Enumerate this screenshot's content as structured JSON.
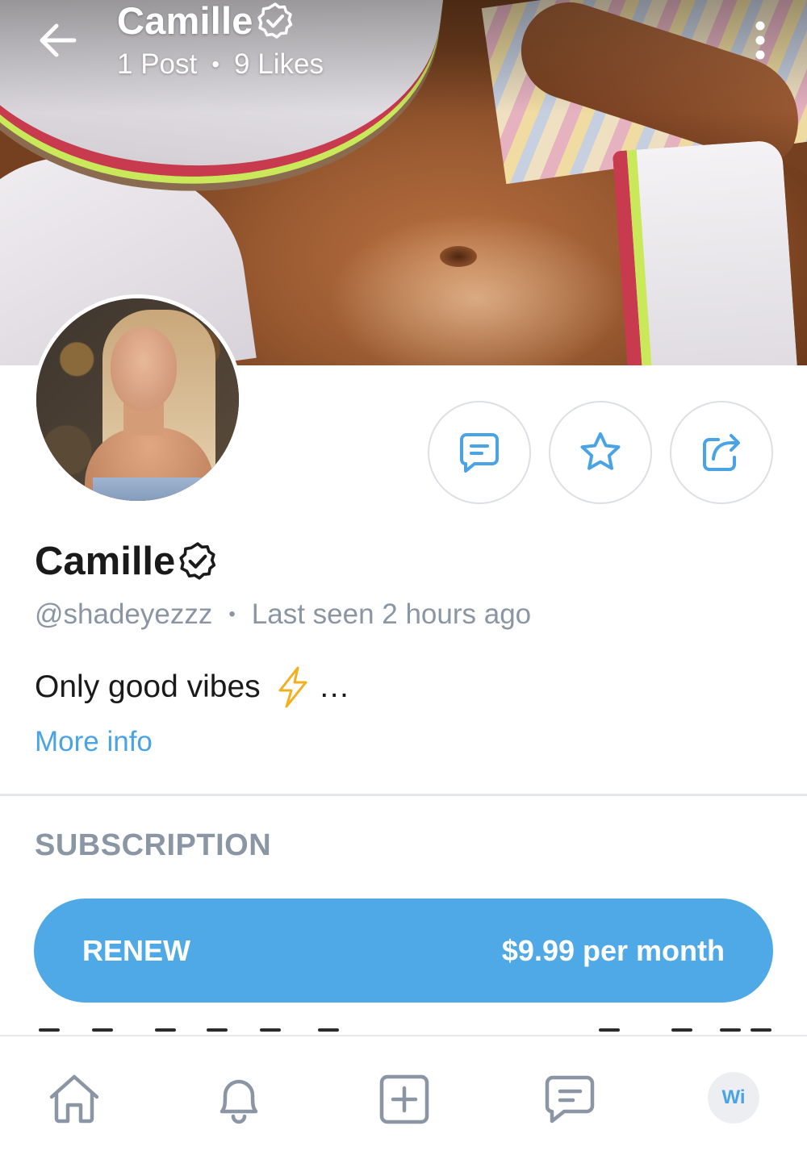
{
  "header": {
    "name": "Camille",
    "posts": "1 Post",
    "likes": "9 Likes",
    "separator": "•"
  },
  "profile": {
    "name": "Camille",
    "handle": "@shadeyezzz",
    "separator": "•",
    "last_seen": "Last seen 2 hours ago",
    "bio_text": "Only good vibes",
    "bio_ellipsis": "…",
    "more_info": "More info"
  },
  "actions": [
    {
      "icon": "message-icon"
    },
    {
      "icon": "star-icon"
    },
    {
      "icon": "share-icon"
    }
  ],
  "subscription": {
    "section_title": "SUBSCRIPTION",
    "renew_label": "RENEW",
    "price": "$9.99 per month"
  },
  "bottom_nav": {
    "items": [
      "home-icon",
      "bell-icon",
      "add-post-icon",
      "messages-icon"
    ],
    "avatar_initials": "Wi"
  },
  "colors": {
    "accent": "#4fa9e6",
    "link": "#4aa3e4",
    "muted_text": "#8a96a3",
    "icon_gray": "#8a96a3",
    "border": "#dcdfe4"
  }
}
